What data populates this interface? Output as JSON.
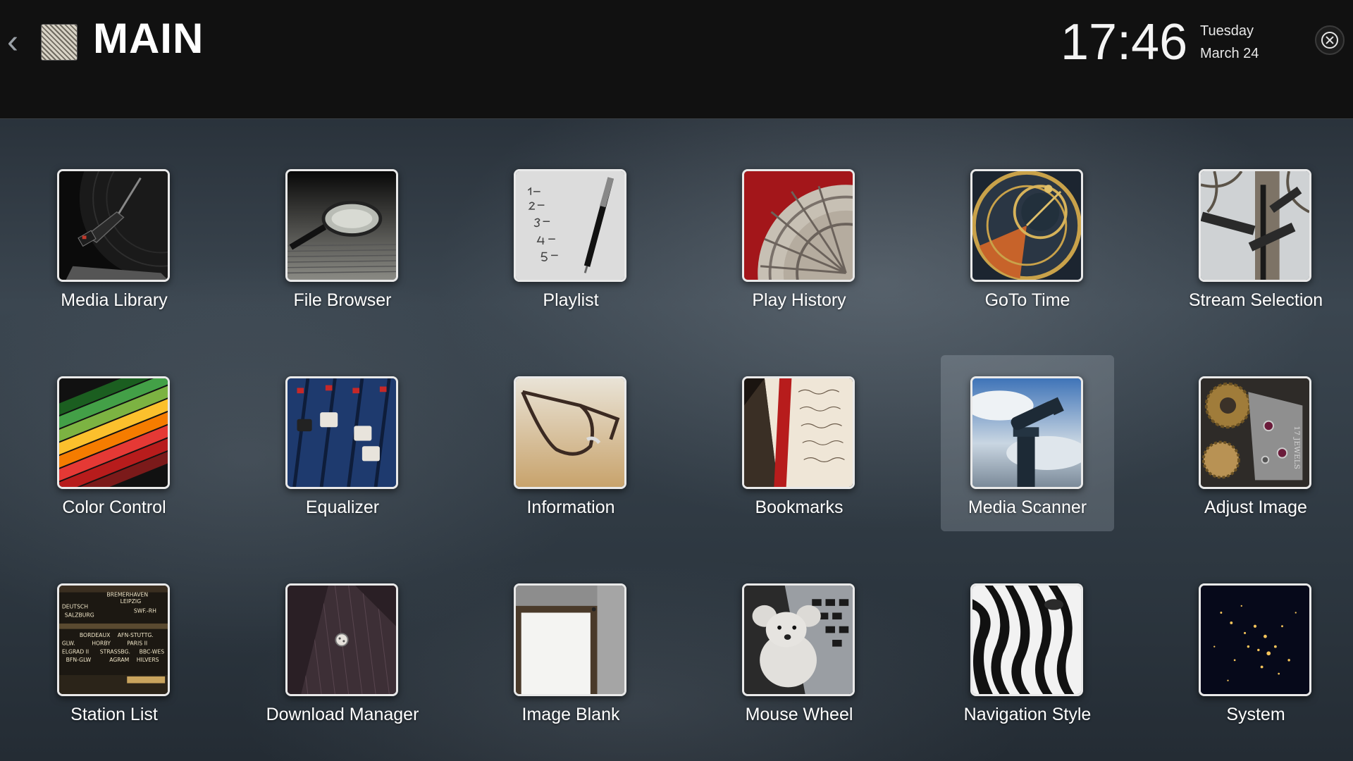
{
  "header": {
    "title": "MAIN",
    "time": "17:46",
    "day": "Tuesday",
    "date": "March 24"
  },
  "tiles": [
    {
      "label": "Media Library",
      "icon": "turntable-icon"
    },
    {
      "label": "File Browser",
      "icon": "magnifier-icon"
    },
    {
      "label": "Playlist",
      "icon": "numbered-list-icon"
    },
    {
      "label": "Play History",
      "icon": "calendar-stone-icon"
    },
    {
      "label": "GoTo Time",
      "icon": "astronomical-clock-icon"
    },
    {
      "label": "Stream Selection",
      "icon": "street-sign-icon"
    },
    {
      "label": "Color Control",
      "icon": "colored-pencils-icon"
    },
    {
      "label": "Equalizer",
      "icon": "mixer-faders-icon"
    },
    {
      "label": "Information",
      "icon": "glasses-icon"
    },
    {
      "label": "Bookmarks",
      "icon": "book-ribbon-icon"
    },
    {
      "label": "Media Scanner",
      "icon": "telescope-icon"
    },
    {
      "label": "Adjust Image",
      "icon": "watch-gears-icon"
    },
    {
      "label": "Station List",
      "icon": "radio-dial-icon"
    },
    {
      "label": "Download Manager",
      "icon": "suit-button-icon"
    },
    {
      "label": "Image Blank",
      "icon": "picture-frame-icon"
    },
    {
      "label": "Mouse Wheel",
      "icon": "plush-mouse-icon"
    },
    {
      "label": "Navigation Style",
      "icon": "zebra-icon"
    },
    {
      "label": "System",
      "icon": "night-earth-icon"
    }
  ],
  "selected_tile": "Media Scanner",
  "station_dial_text": [
    "BREMERHAVEN",
    "LEIPZIG",
    "DEUTSCH",
    "SALZBURG",
    "SWF.-RH",
    "BORDEAUX",
    "AFN-STUTTG.",
    "PARIS II",
    "GLW.",
    "HORBY",
    "ELGRAD II",
    "STRASSBG.",
    "BBC-WES",
    "BFN-GLW",
    "AGRAM",
    "HILVERS"
  ],
  "watch_text": "17 JEWELS"
}
